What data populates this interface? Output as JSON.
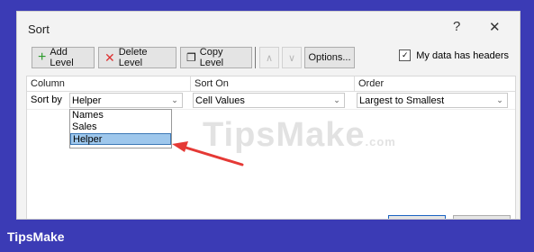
{
  "dialog": {
    "title": "Sort",
    "help_icon": "?",
    "close_icon": "✕"
  },
  "toolbar": {
    "add_level": "Add Level",
    "delete_level": "Delete Level",
    "copy_level": "Copy Level",
    "move_up": "∧",
    "move_down": "∨",
    "options": "Options...",
    "my_data_has_headers": "My data has headers",
    "headers_checked": true
  },
  "grid": {
    "headers": [
      "Column",
      "Sort On",
      "Order"
    ],
    "row": {
      "label": "Sort by",
      "column_value": "Helper",
      "sort_on_value": "Cell Values",
      "order_value": "Largest to Smallest"
    },
    "dropdown_options": [
      "Names",
      "Sales",
      "Helper"
    ],
    "selected_option": "Helper"
  },
  "watermark": {
    "main": "TipsMake",
    "suffix": ".com"
  },
  "brand": "TipsMake",
  "colors": {
    "background": "#3b3bb5",
    "selection": "#9ec7ec",
    "arrow": "#e53935"
  }
}
